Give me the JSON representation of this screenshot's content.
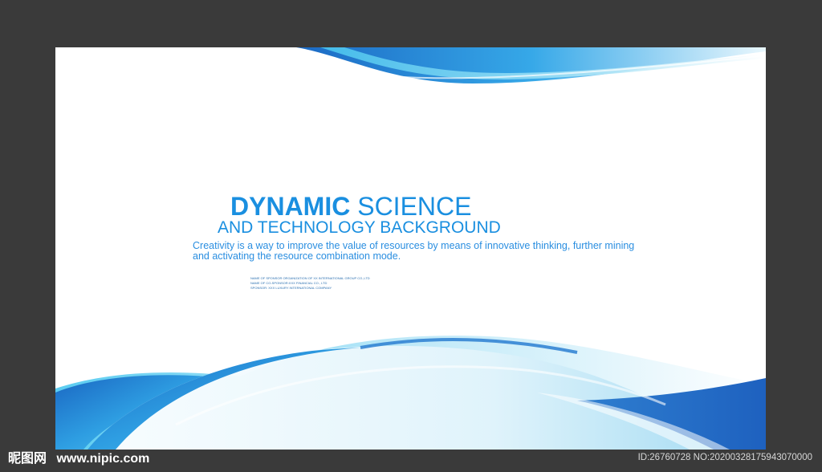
{
  "headline": {
    "bold": "DYNAMIC",
    "light": "SCIENCE",
    "line2": "AND TECHNOLOGY BACKGROUND"
  },
  "description": "Creativity is a way to improve the value of resources by means of innovative thinking, further mining and activating the resource combination mode.",
  "small_print": [
    "NAME OF SPONSOR ORGANIZATION OF XX INTERNATIONAL GROUP CO.,LTD",
    "NAME OF CO-SPONSOR:XXX FINANCIAL CO., LTD",
    "SPONSOR: XXX LUXURY INTERNATIONAL COMPANY"
  ],
  "watermark": {
    "site_cn": "昵图网",
    "site_url": "www.nipic.com",
    "id_text": "ID:26760728 NO:20200328175943070000"
  },
  "colors": {
    "accent": "#1a8fe0",
    "wave_dark": "#1f6fc7",
    "wave_light": "#6fd0f0",
    "frame": "#3a3a3a"
  }
}
